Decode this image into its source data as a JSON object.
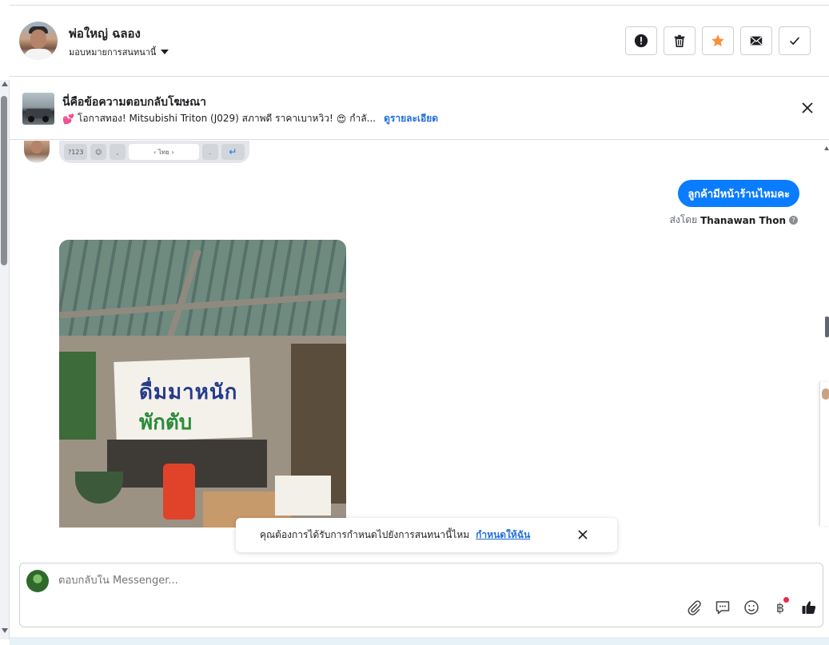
{
  "header": {
    "contact_name": "พ่อใหญ่ ฉลอง",
    "assign_label": "มอบหมายการสนทนานี้",
    "actions": [
      {
        "name": "report",
        "icon": "alert-icon"
      },
      {
        "name": "delete",
        "icon": "trash-icon"
      },
      {
        "name": "star",
        "icon": "star-icon"
      },
      {
        "name": "mark-unread",
        "icon": "envelope-icon"
      },
      {
        "name": "mark-done",
        "icon": "check-icon"
      }
    ]
  },
  "ad_reply": {
    "title": "นี่คือข้อความตอบกลับโฆษณา",
    "description": "โอกาสทอง! Mitsubishi Triton (J029) สภาพดี ราคาเบาหวิว!",
    "truncation": "กำลั...",
    "details_link": "ดูรายละเอียด",
    "emoji_prefix": "💕",
    "emoji_mid": "😍"
  },
  "keyboard_strip": {
    "keys": [
      "?123",
      "☺",
      ",",
      "‹ ไทย ›",
      ".",
      "↵"
    ]
  },
  "messages": {
    "outgoing_text": "ลูกค้ามีหน้าร้านไหมคะ",
    "sent_by_prefix": "ส่งโดย",
    "sent_by_name": "Thanawan Thon",
    "photo_banner_line1": "ดื่มมาหนัก",
    "photo_banner_line2": "พักตับ"
  },
  "toast": {
    "text": "คุณต้องการได้รับการกำหนดไปยังการสนทนานี้ไหม",
    "link": "กำหนดให้ฉัน"
  },
  "composer": {
    "placeholder": "ตอบกลับใน Messenger...",
    "tools": [
      "paperclip-icon",
      "saved-reply-icon",
      "emoji-icon",
      "baht-payment-icon",
      "thumbs-up-icon"
    ],
    "baht_symbol": "฿"
  },
  "colors": {
    "accent": "#0a7cff",
    "link": "#216fdb",
    "star": "#f7923b",
    "notification": "#f02849"
  }
}
